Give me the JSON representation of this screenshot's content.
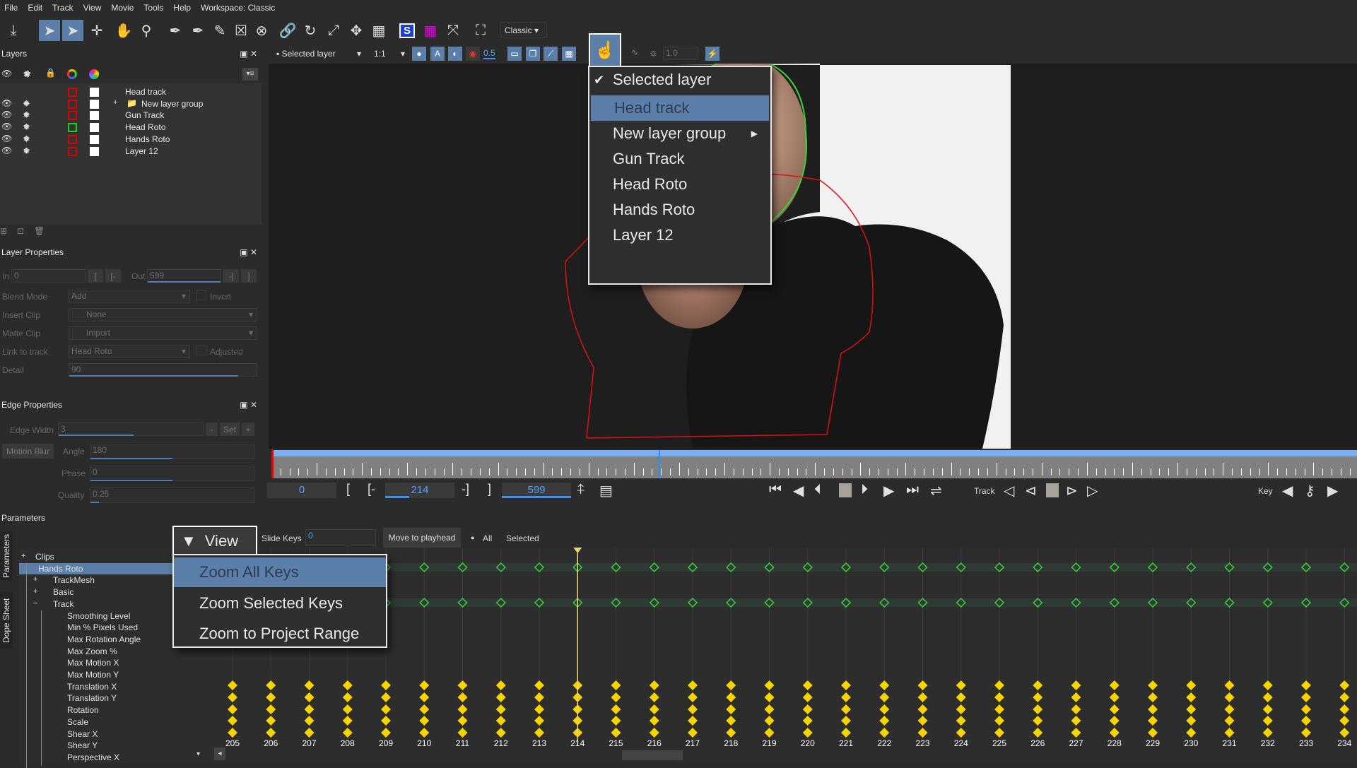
{
  "menubar": {
    "items": [
      "File",
      "Edit",
      "Track",
      "View",
      "Movie",
      "Tools",
      "Help"
    ],
    "workspace": "Workspace: Classic"
  },
  "toolbar": {
    "workspace_select": "Classic"
  },
  "viewer_toolbar": {
    "layer_select": "Selected layer",
    "zoom_select": "1:1",
    "opacity_value": "0.5",
    "exposure_value": "1.0"
  },
  "layers_panel": {
    "title": "Layers",
    "layers": [
      {
        "name": "Head  track",
        "outline_color": "#e00000",
        "visible": false
      },
      {
        "name": "New layer group",
        "outline_color": "#e00000",
        "visible": true,
        "group": true
      },
      {
        "name": "Gun Track",
        "outline_color": "#e00000",
        "visible": true
      },
      {
        "name": "Head Roto",
        "outline_color": "#18d018",
        "visible": true
      },
      {
        "name": "Hands Roto",
        "outline_color": "#e00000",
        "visible": true
      },
      {
        "name": "Layer 12",
        "outline_color": "#e00000",
        "visible": true
      }
    ]
  },
  "layer_properties": {
    "title": "Layer Properties",
    "in_label": "In",
    "in_value": "0",
    "out_label": "Out",
    "out_value": "599",
    "blend_mode_label": "Blend Mode",
    "blend_mode": "Add",
    "invert_label": "Invert",
    "insert_clip_label": "Insert Clip",
    "insert_clip": "None",
    "matte_clip_label": "Matte Clip",
    "matte_clip": "Import",
    "link_label": "Link to track",
    "link_value": "Head Roto",
    "adjusted_label": "Adjusted",
    "detail_label": "Detail",
    "detail_value": "90"
  },
  "edge_properties": {
    "title": "Edge Properties",
    "edge_width_label": "Edge Width",
    "edge_width": "3",
    "minus": "-",
    "set": "Set",
    "plus": "+",
    "motion_blur": "Motion Blur",
    "angle_label": "Angle",
    "angle": "180",
    "phase_label": "Phase",
    "phase": "0",
    "quality_label": "Quality",
    "quality": "0.25"
  },
  "layer_menu": {
    "items": [
      {
        "label": "Selected layer",
        "checked": true
      },
      {
        "label": "Head  track",
        "highlighted": true
      },
      {
        "label": "New layer group",
        "submenu": true
      },
      {
        "label": "Gun Track"
      },
      {
        "label": "Head Roto"
      },
      {
        "label": "Hands Roto"
      },
      {
        "label": "Layer 12"
      }
    ]
  },
  "timeline": {
    "start": "0",
    "in_point": "214",
    "out_point": "599",
    "current_frame": 214,
    "total_frames": 599,
    "in_bracket": "[",
    "in_set": "[-",
    "out_set": "-]",
    "out_bracket": "]",
    "track_label": "Track",
    "key_label": "Key"
  },
  "parameters": {
    "title": "Parameters",
    "side_tabs": [
      "Parameters",
      "Dope Sheet"
    ],
    "view_button": "View",
    "slide_keys_label": "Slide Keys",
    "slide_keys_value": "0",
    "move_to_playhead": "Move to  playhead",
    "all_label": "All",
    "selected_label": "Selected",
    "view_menu": [
      "Zoom All Keys",
      "Zoom Selected Keys",
      "Zoom to Project Range"
    ],
    "tree": [
      {
        "label": "Clips",
        "expander": "+",
        "level": 0
      },
      {
        "label": "Hands Roto",
        "level": 0,
        "selected": true
      },
      {
        "label": "TrackMesh",
        "expander": "+",
        "level": 1
      },
      {
        "label": "Basic",
        "expander": "+",
        "level": 1
      },
      {
        "label": "Track",
        "expander": "−",
        "level": 1
      },
      {
        "label": "Smoothing Level",
        "level": 2
      },
      {
        "label": "Min % Pixels Used",
        "level": 2
      },
      {
        "label": "Max Rotation Angle",
        "level": 2
      },
      {
        "label": "Max Zoom %",
        "level": 2
      },
      {
        "label": "Max Motion X",
        "level": 2
      },
      {
        "label": "Max Motion Y",
        "level": 2
      },
      {
        "label": "Translation X",
        "level": 2
      },
      {
        "label": "Translation Y",
        "level": 2
      },
      {
        "label": "Rotation",
        "level": 2
      },
      {
        "label": "Scale",
        "level": 2
      },
      {
        "label": "Shear X",
        "level": 2
      },
      {
        "label": "Shear Y",
        "level": 2
      },
      {
        "label": "Perspective X",
        "level": 2
      }
    ],
    "frames": [
      205,
      206,
      207,
      208,
      209,
      210,
      211,
      212,
      213,
      214,
      215,
      216,
      217,
      218,
      219,
      220,
      221,
      222,
      223,
      224,
      225,
      226,
      227,
      228,
      229,
      230,
      231,
      232,
      233,
      234
    ],
    "colors": {
      "key_yellow": "#f5d400",
      "key_green": "#3ad13a",
      "playhead": "#e8d77a"
    }
  }
}
